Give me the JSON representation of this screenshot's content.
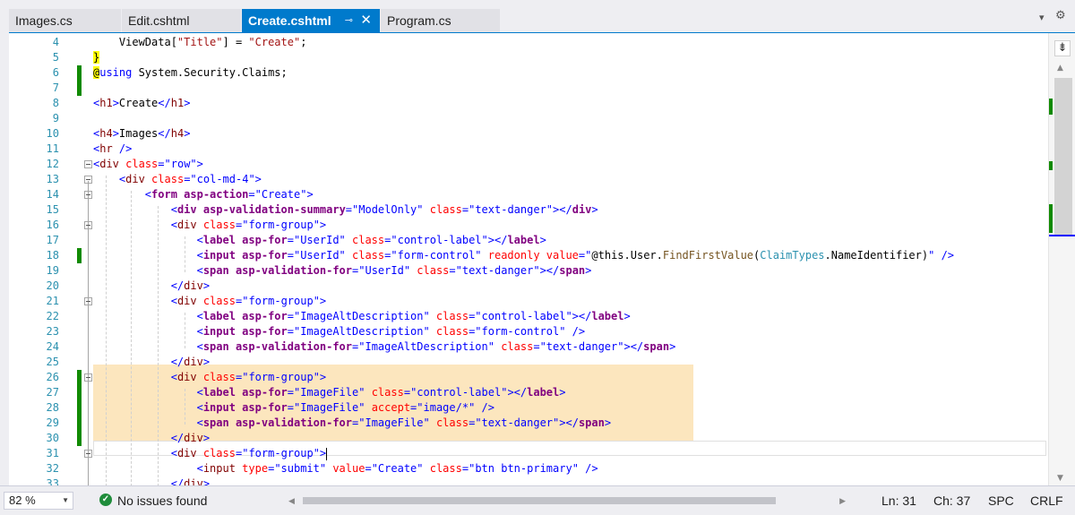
{
  "tabs": [
    {
      "label": "Images.cs",
      "active": false
    },
    {
      "label": "Edit.cshtml",
      "active": false
    },
    {
      "label": "Create.cshtml",
      "active": true
    },
    {
      "label": "Program.cs",
      "active": false
    }
  ],
  "active_tab_icons": {
    "pin": "pin-icon",
    "close": "close-icon"
  },
  "strip_icons": [
    "dropdown-icon",
    "gear-icon"
  ],
  "line_numbers": [
    "4",
    "5",
    "6",
    "7",
    "8",
    "9",
    "10",
    "11",
    "12",
    "13",
    "14",
    "15",
    "16",
    "17",
    "18",
    "19",
    "20",
    "21",
    "22",
    "23",
    "24",
    "25",
    "26",
    "27",
    "28",
    "29",
    "30",
    "31",
    "32",
    "33"
  ],
  "status": {
    "zoom": "82 %",
    "issues": "No issues found",
    "ln": "Ln: 31",
    "ch": "Ch: 37",
    "spc": "SPC",
    "eol": "CRLF"
  },
  "colors": {
    "accent": "#007acc",
    "change_marker": "#108a00",
    "highlight": "#fce6be"
  }
}
